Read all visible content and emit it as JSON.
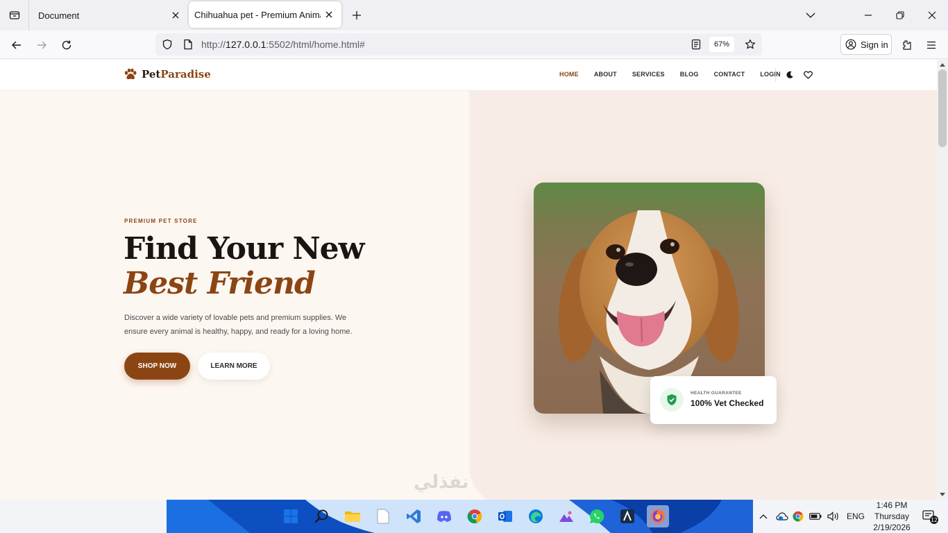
{
  "browser": {
    "tabs": [
      {
        "title": "Document",
        "active": false
      },
      {
        "title": "Chihuahua pet - Premium Animal St",
        "active": true
      }
    ],
    "url_scheme_path_prefix": "http://",
    "url_host": "127.0.0.1",
    "url_rest": ":5502/html/home.html#",
    "zoom": "67%",
    "sign_in_label": "Sign in"
  },
  "site": {
    "logo": {
      "part1": "Pet",
      "part2": "Paradise"
    },
    "menu": [
      {
        "label": "HOME",
        "active": true
      },
      {
        "label": "ABOUT",
        "active": false
      },
      {
        "label": "SERVICES",
        "active": false
      },
      {
        "label": "BLOG",
        "active": false
      },
      {
        "label": "CONTACT",
        "active": false
      },
      {
        "label": "LOGIN",
        "active": false
      }
    ],
    "header_icons": [
      "moon-icon",
      "heart-icon"
    ]
  },
  "hero": {
    "eyebrow": "PREMIUM PET STORE",
    "title_line1": "Find Your New",
    "title_line2": "Best Friend",
    "description": "Discover a wide variety of lovable pets and premium supplies. We ensure every animal is healthy, happy, and ready for a loving home.",
    "primary_button": "SHOP NOW",
    "secondary_button": "LEARN MORE",
    "badge": {
      "subtitle": "HEALTH GUARANTEE",
      "title": "100% Vet Checked"
    }
  },
  "taskbar": {
    "lang": "ENG",
    "time": "1:46 PM",
    "day": "Thursday",
    "date": "2/19/2026",
    "notifications": "12"
  },
  "watermark": "نفذلي",
  "colors": {
    "brand": "#8b4513",
    "page_bg": "#fdf7f2",
    "hero_panel": "#f8ede6"
  }
}
